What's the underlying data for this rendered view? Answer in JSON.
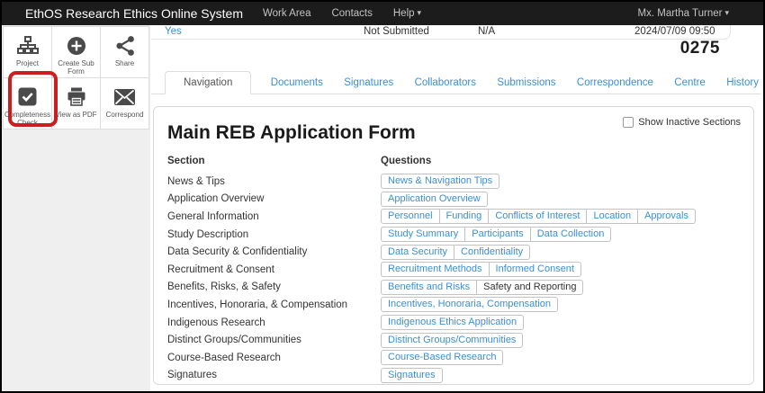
{
  "colors": {
    "accent": "#3a8fd3",
    "annotation": "#cb1f1f",
    "navbar_bg": "#1c1c1c"
  },
  "navbar": {
    "title": "EthOS Research Ethics Online System",
    "links": [
      {
        "label": "Work Area",
        "caret": false
      },
      {
        "label": "Contacts",
        "caret": false
      },
      {
        "label": "Help",
        "caret": true
      }
    ],
    "user": {
      "label": "Mx. Martha Turner",
      "caret": true
    }
  },
  "sidebar": {
    "buttons": [
      {
        "label": "Project",
        "icon": "sitemap-icon"
      },
      {
        "label": "Create Sub Form",
        "icon": "plus-circle-icon"
      },
      {
        "label": "Share",
        "icon": "share-icon"
      },
      {
        "label": "Completeness Check",
        "icon": "check-square-icon",
        "highlighted": true
      },
      {
        "label": "View as PDF",
        "icon": "printer-icon"
      },
      {
        "label": "Correspond",
        "icon": "envelope-icon"
      }
    ]
  },
  "status_strip": {
    "link": "Yes",
    "submission_status": "Not Submitted",
    "na": "N/A",
    "timestamp": "2024/07/09 09:50",
    "form_number": "0275"
  },
  "tabs": [
    {
      "label": "Navigation",
      "active": true
    },
    {
      "label": "Documents",
      "active": false
    },
    {
      "label": "Signatures",
      "active": false
    },
    {
      "label": "Collaborators",
      "active": false
    },
    {
      "label": "Submissions",
      "active": false
    },
    {
      "label": "Correspondence",
      "active": false
    },
    {
      "label": "Centre",
      "active": false
    },
    {
      "label": "History",
      "active": false
    }
  ],
  "main": {
    "title": "Main REB Application Form",
    "show_inactive_label": "Show Inactive Sections",
    "columns": [
      "Section",
      "Questions"
    ],
    "rows": [
      {
        "section": "News & Tips",
        "questions": [
          {
            "label": "News & Navigation Tips"
          }
        ]
      },
      {
        "section": "Application Overview",
        "questions": [
          {
            "label": "Application Overview"
          }
        ]
      },
      {
        "section": "General Information",
        "questions": [
          {
            "label": "Personnel"
          },
          {
            "label": "Funding"
          },
          {
            "label": "Conflicts of Interest"
          },
          {
            "label": "Location"
          },
          {
            "label": "Approvals"
          }
        ]
      },
      {
        "section": "Study Description",
        "questions": [
          {
            "label": "Study Summary"
          },
          {
            "label": "Participants"
          },
          {
            "label": "Data Collection"
          }
        ]
      },
      {
        "section": "Data Security & Confidentiality",
        "questions": [
          {
            "label": "Data Security"
          },
          {
            "label": "Confidentiality"
          }
        ]
      },
      {
        "section": "Recruitment & Consent",
        "questions": [
          {
            "label": "Recruitment Methods"
          },
          {
            "label": "Informed Consent"
          }
        ]
      },
      {
        "section": "Benefits, Risks, & Safety",
        "questions": [
          {
            "label": "Benefits and Risks"
          },
          {
            "label": "Safety and Reporting",
            "muted": true
          }
        ]
      },
      {
        "section": "Incentives, Honoraria, & Compensation",
        "questions": [
          {
            "label": "Incentives, Honoraria, Compensation"
          }
        ]
      },
      {
        "section": "Indigenous Research",
        "questions": [
          {
            "label": "Indigenous Ethics Application"
          }
        ]
      },
      {
        "section": "Distinct Groups/Communities",
        "questions": [
          {
            "label": "Distinct Groups/Communities"
          }
        ]
      },
      {
        "section": "Course-Based Research",
        "questions": [
          {
            "label": "Course-Based Research"
          }
        ]
      },
      {
        "section": "Signatures",
        "questions": [
          {
            "label": "Signatures"
          }
        ]
      }
    ]
  }
}
